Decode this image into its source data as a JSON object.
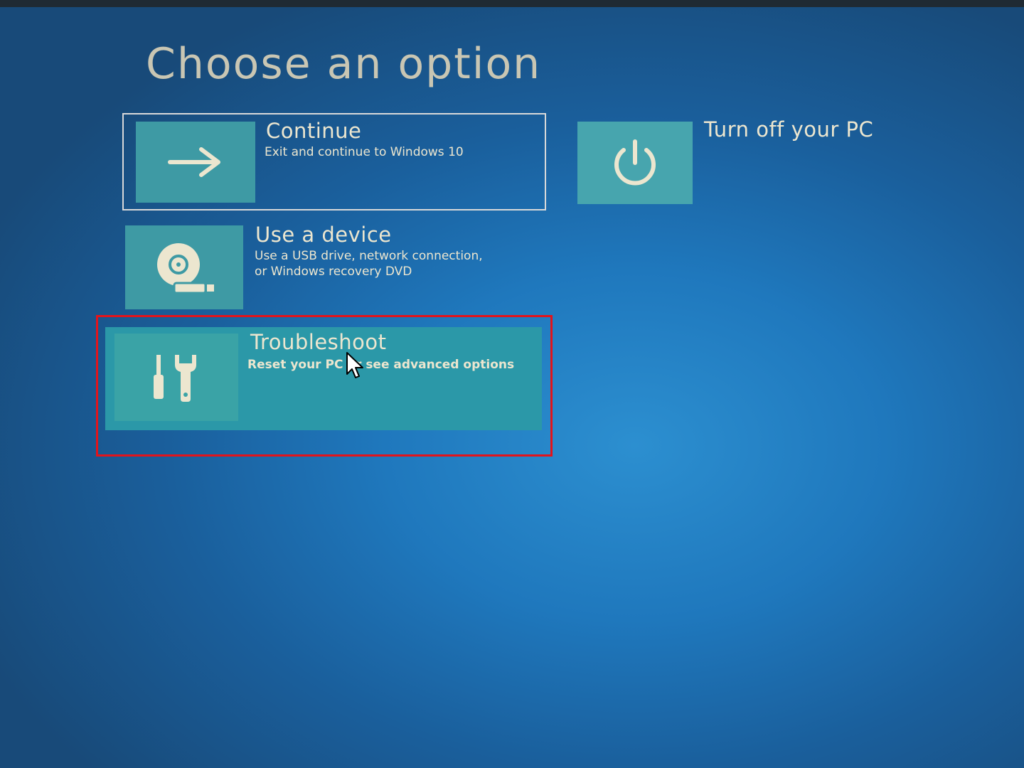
{
  "page": {
    "title": "Choose an option"
  },
  "options": {
    "continue": {
      "title": "Continue",
      "description": "Exit and continue to Windows 10",
      "icon": "arrow-right-icon"
    },
    "turn_off": {
      "title": "Turn off your PC",
      "icon": "power-icon"
    },
    "use_device": {
      "title": "Use a device",
      "description_line1": "Use a USB drive, network connection,",
      "description_line2": "or Windows recovery DVD",
      "icon": "disc-drive-icon"
    },
    "troubleshoot": {
      "title": "Troubleshoot",
      "description": "Reset your PC or see advanced options",
      "icon": "tools-icon",
      "highlighted": true
    }
  },
  "colors": {
    "background": "#1f78bd",
    "tile_accent": "#3e9aa4",
    "highlight_border": "#e3141b",
    "text": "#ece6cf"
  }
}
